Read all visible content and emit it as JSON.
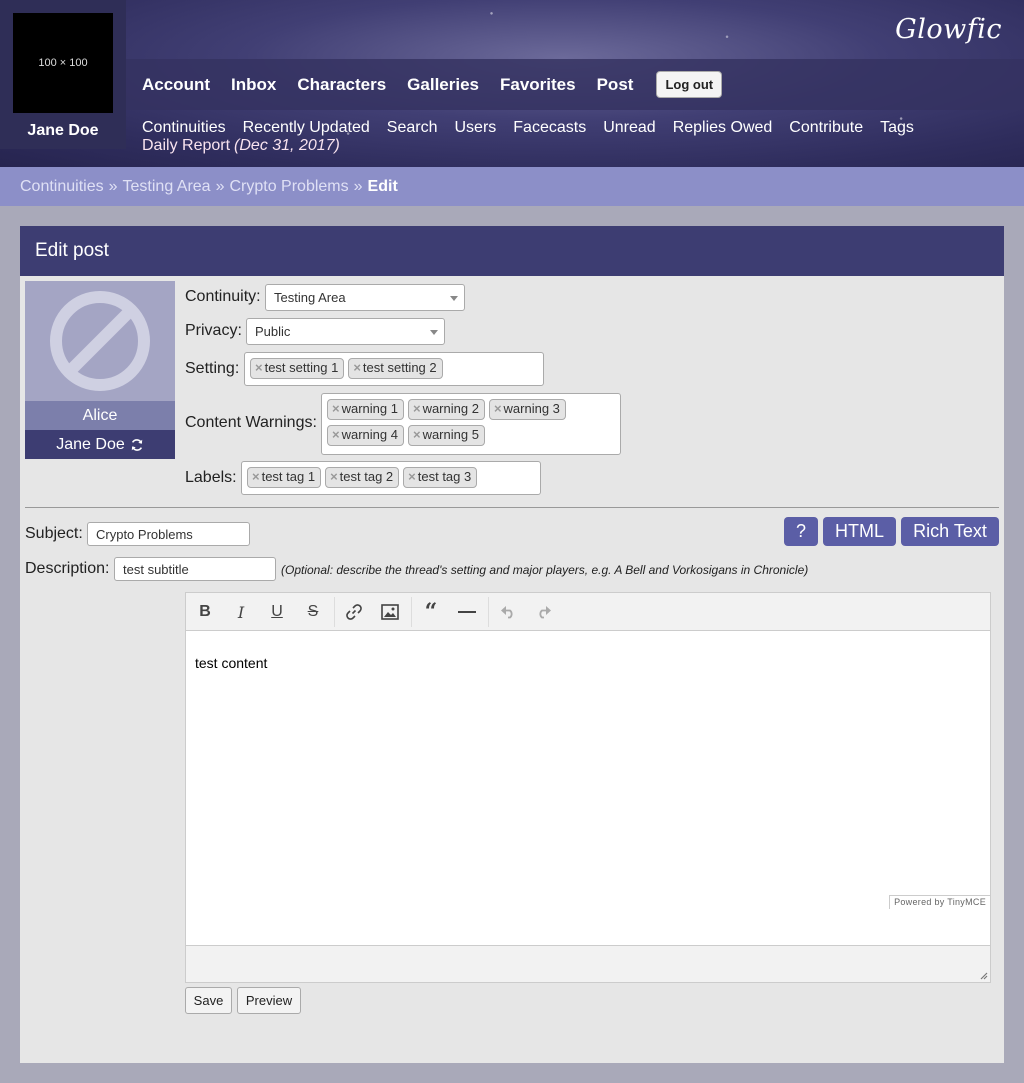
{
  "header": {
    "logo": "Glowfic",
    "avatar_placeholder": "100 × 100",
    "username": "Jane Doe",
    "main_nav": [
      "Account",
      "Inbox",
      "Characters",
      "Galleries",
      "Favorites",
      "Post"
    ],
    "logout_label": "Log out",
    "sub_nav": [
      "Continuities",
      "Recently Updated",
      "Search",
      "Users",
      "Facecasts",
      "Unread",
      "Replies Owed",
      "Contribute",
      "Tags"
    ],
    "daily_report": "Daily Report",
    "daily_report_date": "(Dec 31, 2017)"
  },
  "breadcrumb": {
    "items": [
      "Continuities",
      "Testing Area",
      "Crypto Problems"
    ],
    "separator": "»",
    "current": "Edit"
  },
  "panel": {
    "title": "Edit post",
    "character": {
      "name": "Alice",
      "user": "Jane Doe",
      "icon": "no-icon",
      "switch_icon": "refresh-icon"
    },
    "continuity": {
      "label": "Continuity:",
      "value": "Testing Area"
    },
    "privacy": {
      "label": "Privacy:",
      "value": "Public"
    },
    "setting": {
      "label": "Setting:",
      "tags": [
        "test setting 1",
        "test setting 2"
      ]
    },
    "warnings": {
      "label": "Content Warnings:",
      "tags": [
        "warning 1",
        "warning 2",
        "warning 3",
        "warning 4",
        "warning 5"
      ]
    },
    "labels": {
      "label": "Labels:",
      "tags": [
        "test tag 1",
        "test tag 2",
        "test tag 3"
      ]
    },
    "tag_remove": "×",
    "subject": {
      "label": "Subject:",
      "value": "Crypto Problems"
    },
    "description": {
      "label": "Description:",
      "value": "test subtitle",
      "hint": "(Optional: describe the thread's setting and major players, e.g. A Bell and Vorkosigans in Chronicle)"
    },
    "mode_buttons": {
      "help": "?",
      "html": "HTML",
      "rich": "Rich Text"
    },
    "editor": {
      "content": "test content",
      "powered_by": "Powered by TinyMCE",
      "toolbar": [
        "bold",
        "italic",
        "underline",
        "strikethrough",
        "link",
        "image",
        "blockquote",
        "horizontal-rule",
        "undo",
        "redo"
      ]
    },
    "save_label": "Save",
    "preview_label": "Preview"
  }
}
